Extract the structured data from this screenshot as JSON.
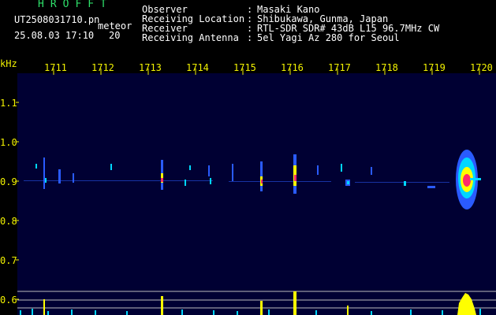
{
  "station": {
    "name": "HROFFT"
  },
  "file": {
    "name": "UT2508031710.pn",
    "suffix": "meteor"
  },
  "capture": {
    "datetime": "25.08.03 17:10",
    "count": "20"
  },
  "header": {
    "rows": [
      {
        "label": "Observer",
        "value": "Masaki Kano"
      },
      {
        "label": "Receiving Location",
        "value": "Shibukawa, Gunma, Japan"
      },
      {
        "label": "Receiver",
        "value": "RTL-SDR SDR# 43dB L15 96.7MHz CW"
      },
      {
        "label": "Receiving Antenna",
        "value": "5el Yagi Az 280 for Seoul"
      }
    ]
  },
  "axis": {
    "unit": "kHz",
    "x_ticks": [
      "1711",
      "1712",
      "1713",
      "1714",
      "1715",
      "1716",
      "1717",
      "1718",
      "1719",
      "1720"
    ],
    "y_ticks": [
      "1.1",
      "1.0",
      "0.9",
      "0.8",
      "0.7",
      "0.6"
    ]
  },
  "colors": {
    "background": "#000000",
    "plot": "#000033",
    "header_text": "#ffffff",
    "title_text": "#2ee06a",
    "axis_text": "#f2f200",
    "echo_cyan": "#00d7ff",
    "echo_blue": "#2a5bff",
    "echo_yellow": "#ffff00",
    "echo_red": "#ff2a6a"
  }
}
